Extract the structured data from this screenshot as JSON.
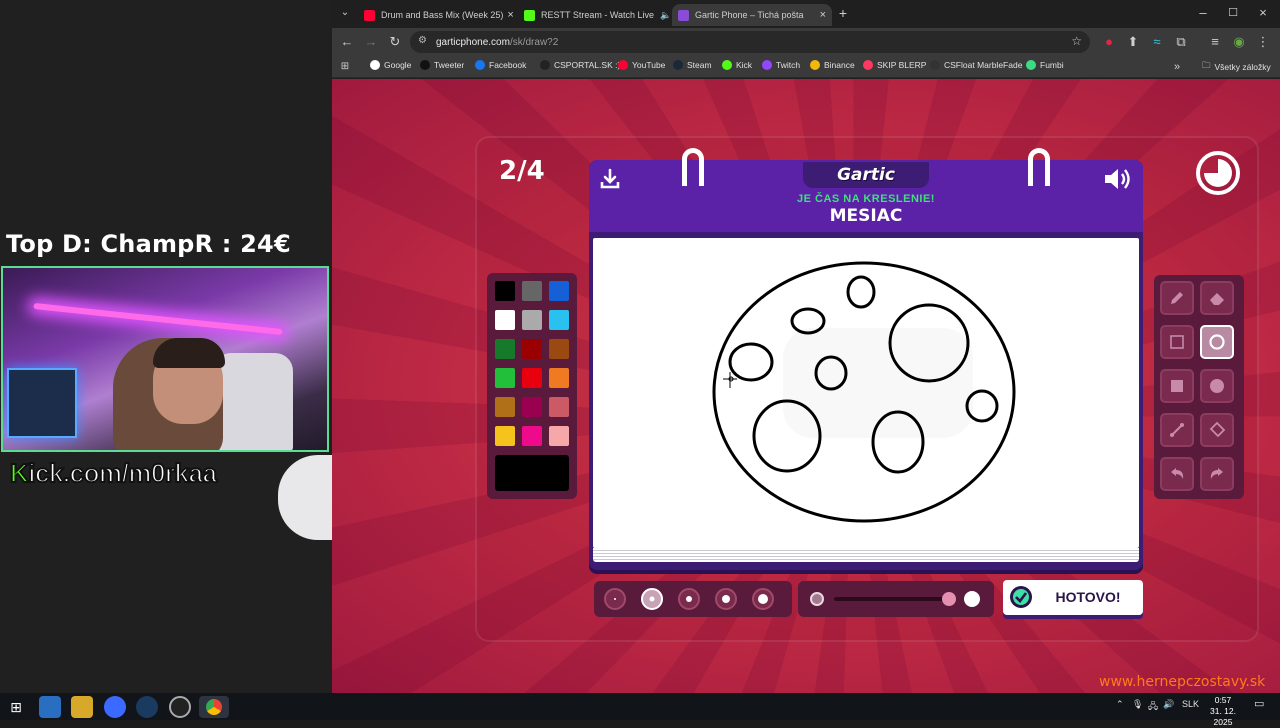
{
  "overlay": {
    "top_donor": "Top D: ChampR : 24€",
    "kick_prefix": "K",
    "kick_rest": "ick.com/m0rkaa"
  },
  "browser": {
    "tabs": [
      {
        "title": "Drum and Bass Mix (Week 25)",
        "favicon_color": "#ff0033"
      },
      {
        "title": "RESTT Stream - Watch Live",
        "favicon_color": "#53fc18"
      },
      {
        "title": "Gartic Phone – Tichá pošta",
        "favicon_color": "#8a4cd6"
      }
    ],
    "new_tab": "+",
    "url_host": "garticphone.com",
    "url_path": "/sk/draw?2",
    "bookmarks": [
      {
        "label": "Google",
        "color": "#ffffff"
      },
      {
        "label": "Tweeter",
        "color": "#111111"
      },
      {
        "label": "Facebook",
        "color": "#1877f2"
      },
      {
        "label": "CSPORTAL.SK :)",
        "color": "#222222"
      },
      {
        "label": "YouTube",
        "color": "#ff0033"
      },
      {
        "label": "Steam",
        "color": "#1b2838"
      },
      {
        "label": "Kick",
        "color": "#53fc18"
      },
      {
        "label": "Twitch",
        "color": "#9146ff"
      },
      {
        "label": "Binance",
        "color": "#f0b90b"
      },
      {
        "label": "SKIP BLERP",
        "color": "#ff3860"
      },
      {
        "label": "CSFloat MarbleFade",
        "color": "#333333"
      },
      {
        "label": "Fumbi",
        "color": "#3ddc84"
      }
    ],
    "all_bookmarks": "Všetky záložky"
  },
  "game": {
    "round": "2/4",
    "logo": "Gartic",
    "subtitle": "JE ČAS NA KRESLENIE!",
    "word": "MESIAC",
    "done_label": "HOTOVO!",
    "palette": [
      "#000000",
      "#666666",
      "#1560d6",
      "#ffffff",
      "#aaaaaa",
      "#29c1f0",
      "#157a2a",
      "#9a0000",
      "#9a4a10",
      "#22c03a",
      "#e8000e",
      "#f07a22",
      "#b07018",
      "#9a0050",
      "#cc5a66",
      "#f6c21c",
      "#ee0a8a",
      "#f6a8a8"
    ],
    "current_color": "#000000",
    "tools": [
      "pencil-tool",
      "eraser-tool",
      "rectangle-outline-tool",
      "ellipse-outline-tool",
      "rectangle-fill-tool",
      "ellipse-fill-tool",
      "line-tool",
      "bucket-tool",
      "undo-tool",
      "redo-tool"
    ],
    "active_tool": "ellipse-outline-tool",
    "brush_sizes": 5,
    "active_size": 2,
    "opacity_level": 0.93,
    "watermark": "www.hernepczostavy.sk"
  },
  "taskbar": {
    "language": "SLK",
    "time": "0:57",
    "date": "31. 12. 2025"
  }
}
